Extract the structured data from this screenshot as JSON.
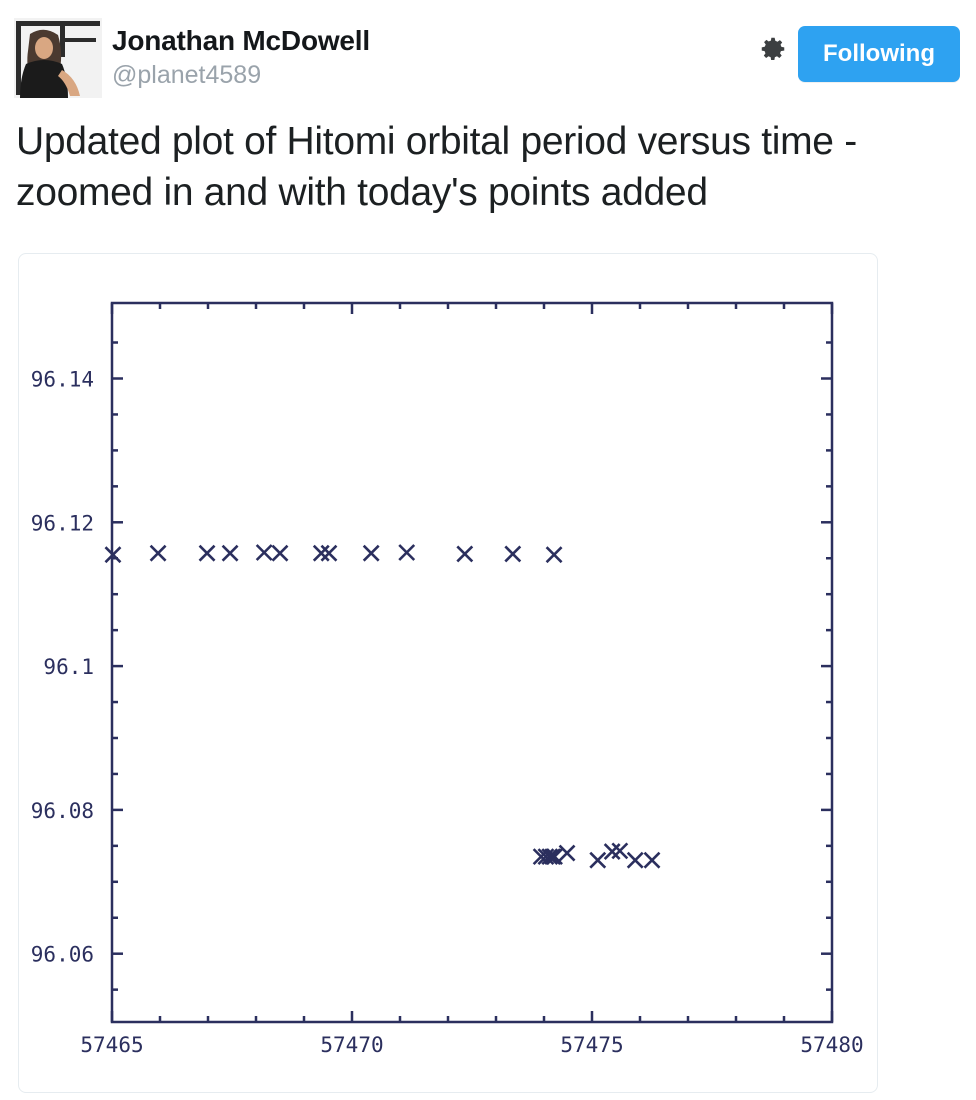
{
  "header": {
    "fullname": "Jonathan McDowell",
    "handle": "@planet4589",
    "follow_label": "Following",
    "gear_icon": "gear-icon",
    "avatar_alt": "avatar"
  },
  "tweet": {
    "text": "Updated plot of Hitomi orbital period versus time - zoomed in and with today's points added"
  },
  "colors": {
    "accent": "#2ea2f1",
    "plot_ink": "#2b2f5e",
    "card_border": "#e6ecf0",
    "text": "#1c2022",
    "handle": "#9aa3ab"
  },
  "chart_data": {
    "type": "scatter",
    "title": "",
    "xlabel": "",
    "ylabel": "",
    "xlim": [
      57465,
      57480
    ],
    "ylim": [
      96.0505,
      96.1505
    ],
    "grid": false,
    "legend": null,
    "marker": "x",
    "marker_color": "#2b2f5e",
    "xticks": [
      57465,
      57470,
      57475,
      57480
    ],
    "xtick_labels": [
      "57465",
      "57470",
      "57475",
      "57480"
    ],
    "x_minor_ticks": [
      57466,
      57467,
      57468,
      57469,
      57471,
      57472,
      57473,
      57474,
      57476,
      57477,
      57478,
      57479
    ],
    "yticks": [
      96.06,
      96.08,
      96.1,
      96.12,
      96.14
    ],
    "ytick_labels": [
      "96.06",
      "96.08",
      "96.1",
      "96.12",
      "96.14"
    ],
    "y_minor_ticks": [
      96.055,
      96.065,
      96.07,
      96.075,
      96.085,
      96.09,
      96.095,
      96.105,
      96.11,
      96.115,
      96.125,
      96.13,
      96.135,
      96.145
    ],
    "series": [
      {
        "name": "Hitomi orbital period",
        "points": [
          [
            57465.02,
            96.1155
          ],
          [
            57465.96,
            96.1157
          ],
          [
            57466.98,
            96.1157
          ],
          [
            57467.46,
            96.1157
          ],
          [
            57468.17,
            96.1158
          ],
          [
            57468.5,
            96.1157
          ],
          [
            57469.36,
            96.1157
          ],
          [
            57469.52,
            96.1157
          ],
          [
            57470.4,
            96.1157
          ],
          [
            57471.14,
            96.1158
          ],
          [
            57472.35,
            96.1156
          ],
          [
            57473.35,
            96.1156
          ],
          [
            57474.21,
            96.1155
          ],
          [
            57473.94,
            96.0735
          ],
          [
            57474.04,
            96.0735
          ],
          [
            57474.12,
            96.0735
          ],
          [
            57474.18,
            96.0735
          ],
          [
            57474.22,
            96.0735
          ],
          [
            57474.48,
            96.074
          ],
          [
            57475.12,
            96.073
          ],
          [
            57475.42,
            96.0742
          ],
          [
            57475.58,
            96.0743
          ],
          [
            57475.9,
            96.073
          ],
          [
            57476.25,
            96.073
          ]
        ]
      }
    ]
  }
}
